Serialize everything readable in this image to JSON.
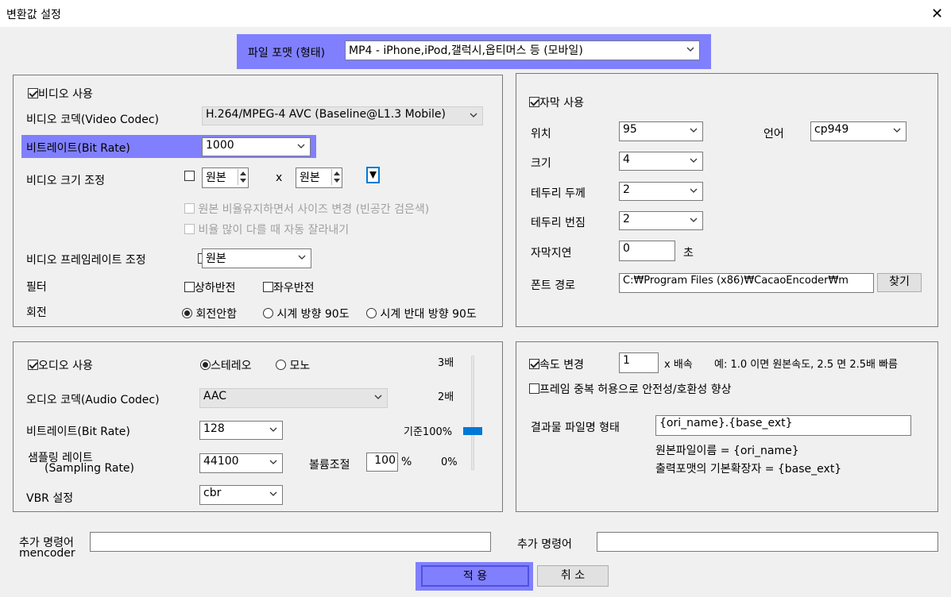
{
  "window": {
    "title": "변환값 설정",
    "close_glyph": "✕"
  },
  "format": {
    "label": "파일 포맷 (형태)",
    "value": "MP4 - iPhone,iPod,갤럭시,옵티머스 등 (모바일)"
  },
  "video": {
    "use_label": "비디오 사용",
    "codec_label": "비디오 코덱(Video Codec)",
    "codec_value": "H.264/MPEG-4 AVC (Baseline@L1.3 Mobile)",
    "bitrate_label": "비트레이트(Bit Rate)",
    "bitrate_value": "1000",
    "resize_label": "비디오 크기 조정",
    "width_value": "원본",
    "height_value": "원본",
    "times": "x",
    "keep_ratio_label": "원본 비율유지하면서 사이즈 변경 (빈공간 검은색)",
    "crop_label": "비율 많이 다를 때 자동 잘라내기",
    "framerate_label": "비디오 프레임레이트 조정",
    "framerate_value": "원본",
    "filter_label": "필터",
    "flip_v_label": "상하반전",
    "flip_h_label": "좌우반전",
    "rotate_label": "회전",
    "rotate_none": "회전안함",
    "rotate_cw": "시계 방향 90도",
    "rotate_ccw": "시계 반대 방향 90도"
  },
  "subtitle": {
    "use_label": "자막 사용",
    "position_label": "위치",
    "position_value": "95",
    "language_label": "언어",
    "language_value": "cp949",
    "size_label": "크기",
    "size_value": "4",
    "border_width_label": "테두리 두께",
    "border_width_value": "2",
    "border_blur_label": "테두리 번짐",
    "border_blur_value": "2",
    "delay_label": "자막지연",
    "delay_value": "0",
    "delay_unit": "초",
    "font_label": "폰트 경로",
    "font_value": "C:₩Program Files (x86)₩CacaoEncoder₩m",
    "browse_label": "찾기"
  },
  "audio": {
    "use_label": "오디오 사용",
    "stereo_label": "스테레오",
    "mono_label": "모노",
    "codec_label": "오디오 코덱(Audio Codec)",
    "codec_value": "AAC",
    "bitrate_label": "비트레이트(Bit Rate)",
    "bitrate_value": "128",
    "sampling_label_1": "샘플링 레이트",
    "sampling_label_2": "(Sampling Rate)",
    "sampling_value": "44100",
    "volume_label": "볼륨조절",
    "volume_value": "100",
    "volume_unit": "%",
    "vbr_label": "VBR 설정",
    "vbr_value": "cbr",
    "scale_3x": "3배",
    "scale_2x": "2배",
    "scale_100": "기준100%",
    "scale_0": "0%",
    "slider_level_fraction": 0.33
  },
  "speed": {
    "use_label": "속도 변경",
    "value": "1",
    "unit_label": "x 배속",
    "hint": "예: 1.0 이면 원본속도, 2.5 면 2.5배 빠름",
    "frame_dup_label": "프레임 중복 허용으로 안전성/호환성 향상",
    "output_name_label": "결과물 파일명 형태",
    "output_name_value": "{ori_name}.{base_ext}",
    "help_1": "원본파일이름 = {ori_name}",
    "help_2": "출력포맷의 기본확장자 = {base_ext}"
  },
  "extra": {
    "mencoder_label_1": "추가 명령어",
    "mencoder_label_2": "mencoder",
    "mencoder_value": "",
    "cmd_label": "추가 명령어",
    "cmd_value": ""
  },
  "buttons": {
    "apply": "적 용",
    "cancel": "취 소"
  },
  "colors": {
    "highlight": "#8080ff",
    "slider_thumb": "#0078d7",
    "disabled_text": "#a0a0a0"
  }
}
